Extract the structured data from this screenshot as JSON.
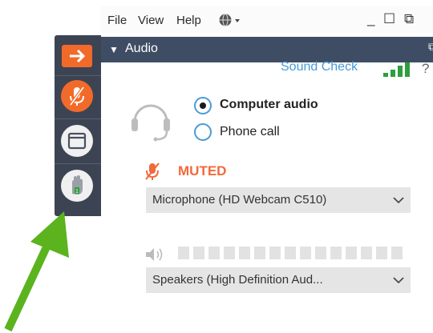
{
  "menu": {
    "file": "File",
    "view": "View",
    "help": "Help"
  },
  "window_controls": {
    "minimize": "_",
    "maximize": "☐",
    "restore": "⧉"
  },
  "audio_panel": {
    "title": "Audio",
    "sound_check": "Sound Check",
    "help_label": "?",
    "radio_options": [
      {
        "label": "Computer audio",
        "selected": true
      },
      {
        "label": "Phone call",
        "selected": false
      }
    ],
    "mute_status": "MUTED",
    "microphone": "Microphone (HD Webcam C510)",
    "speakers": "Speakers (High Definition Aud..."
  },
  "icons": {
    "globe": "globe-icon",
    "headset": "headset-icon",
    "muted_mic": "muted-mic-icon",
    "speaker": "speaker-icon",
    "sidebar": [
      "orange-arrow-icon",
      "muted-mic-button-icon",
      "screen-icon",
      "raise-hand-icon"
    ]
  },
  "colors": {
    "accent_orange": "#f26a2a",
    "sidebar_bg": "#3c4453",
    "header_bg": "#3f4d64",
    "link_blue": "#4a9bd6",
    "signal_green": "#2e9e3e",
    "annotation_green": "#5bb31e"
  }
}
